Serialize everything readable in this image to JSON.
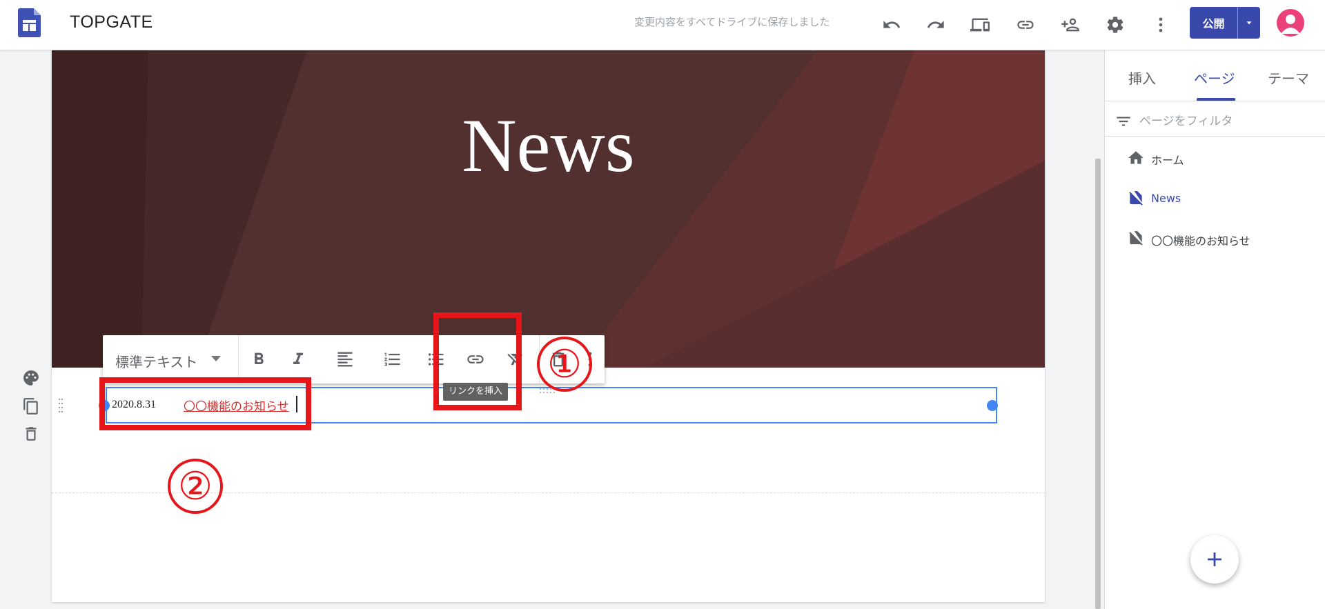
{
  "header": {
    "site_name": "TOPGATE",
    "save_status": "変更内容をすべてドライブに保存しました",
    "publish_label": "公開",
    "icons": [
      "undo-icon",
      "redo-icon",
      "preview-devices-icon",
      "link-icon",
      "share-add-person-icon",
      "settings-gear-icon",
      "more-vert-icon"
    ]
  },
  "canvas": {
    "header_title": "News",
    "row": {
      "date": "2020.8.31",
      "link_text": "〇〇機能のお知らせ"
    }
  },
  "toolbar": {
    "style_label": "標準テキスト",
    "tooltip": "リンクを挿入",
    "buttons": [
      "bold-icon",
      "italic-icon",
      "align-left-icon",
      "numbered-list-icon",
      "bulleted-list-icon",
      "insert-link-icon",
      "clear-format-icon",
      "delete-icon",
      "more-vert-icon"
    ]
  },
  "annotations": {
    "one": "①",
    "two": "②",
    "color": "#e5151a"
  },
  "side_panel": {
    "tabs": [
      {
        "label": "挿入",
        "active": false
      },
      {
        "label": "ページ",
        "active": true
      },
      {
        "label": "テーマ",
        "active": false
      }
    ],
    "filter_placeholder": "ページをフィルタ",
    "pages": [
      {
        "label": "ホーム",
        "icon": "home-icon",
        "active": false
      },
      {
        "label": "News",
        "icon": "page-hidden-icon",
        "active": true
      },
      {
        "label": "〇〇機能のお知らせ",
        "icon": "page-hidden-icon",
        "active": false
      }
    ],
    "add_button_icon": "plus-icon"
  },
  "colors": {
    "accent": "#3949ab",
    "selection": "#4285f4",
    "header_bg": "#4e2c2c",
    "link": "#d32f2f"
  }
}
